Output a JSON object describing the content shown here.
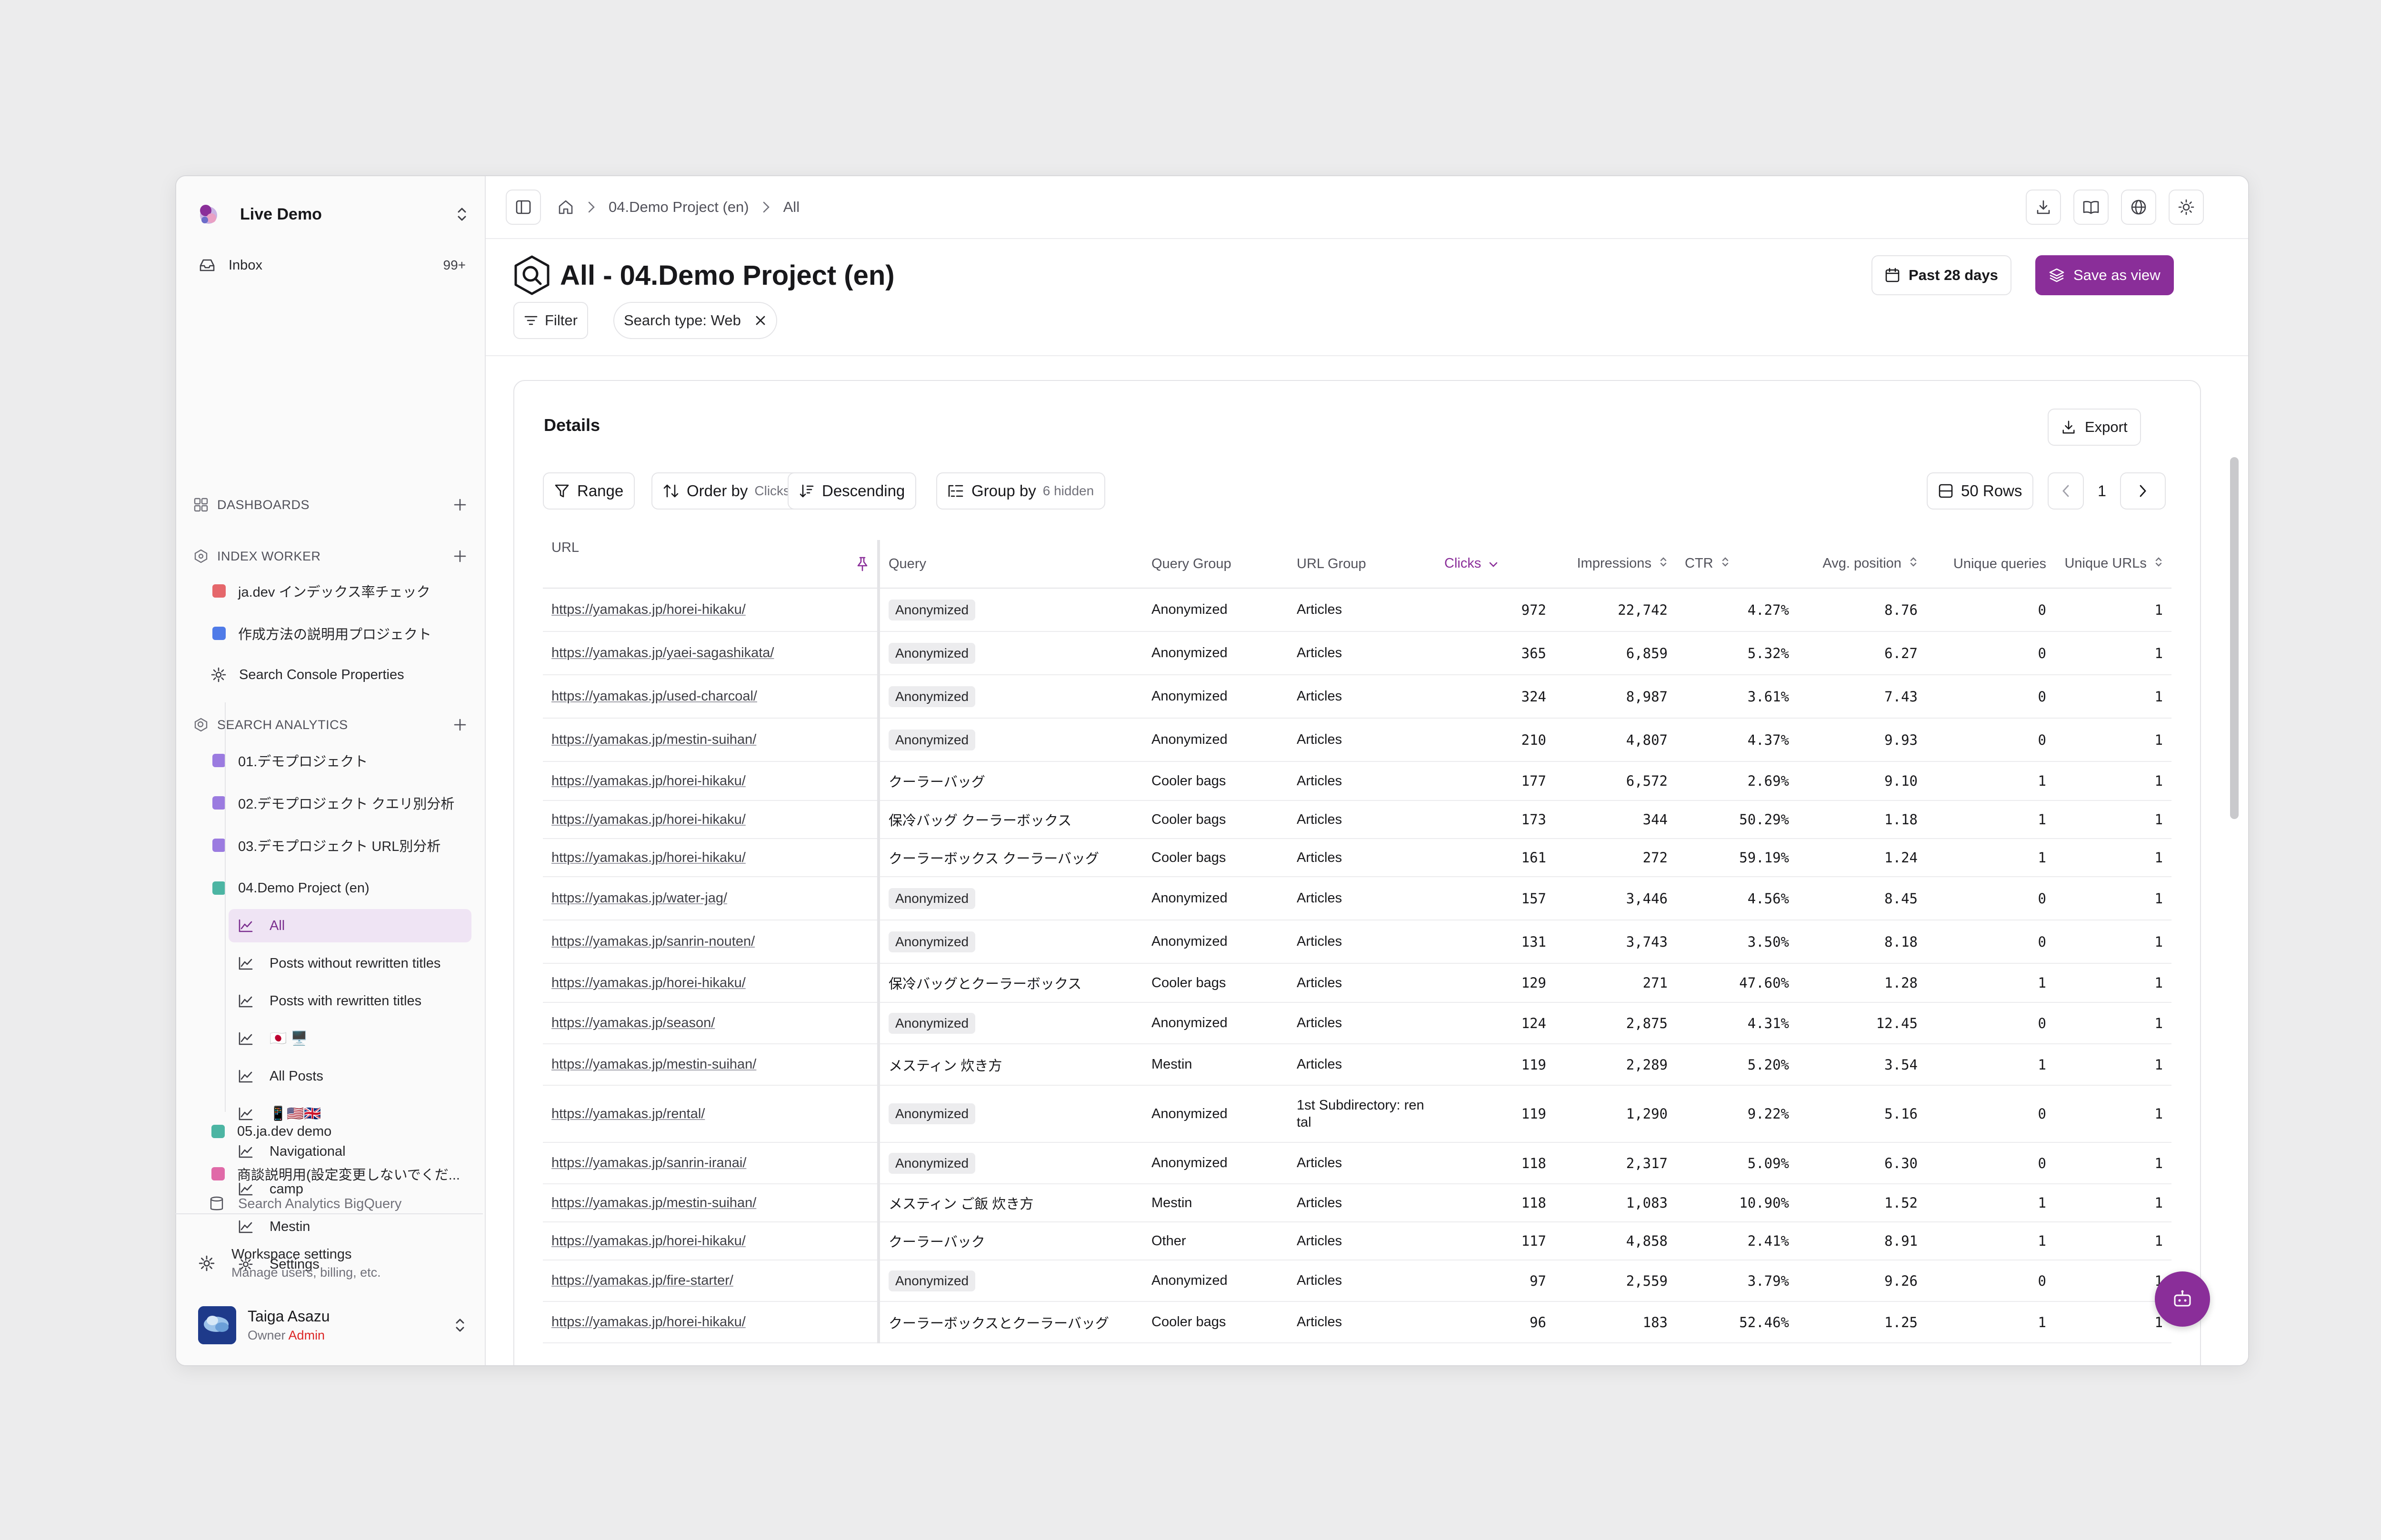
{
  "workspace": {
    "name": "Live Demo"
  },
  "inbox": {
    "label": "Inbox",
    "count": "99+"
  },
  "sections": {
    "dashboards": "DASHBOARDS",
    "index_worker": "INDEX WORKER",
    "search_analytics": "SEARCH ANALYTICS"
  },
  "index_worker_items": [
    {
      "label": "ja.dev インデックス率チェック",
      "color": "#e5676b"
    },
    {
      "label": "作成方法の説明用プロジェクト",
      "color": "#4f7be8"
    },
    {
      "label": "Search Console Properties",
      "icon": "gear-icon"
    }
  ],
  "analytics_items": [
    {
      "label": "01.デモプロジェクト",
      "color": "#9b7be0"
    },
    {
      "label": "02.デモプロジェクト クエリ別分析",
      "color": "#9b7be0"
    },
    {
      "label": "03.デモプロジェクト URL別分析",
      "color": "#9b7be0"
    },
    {
      "label": "04.Demo Project (en)",
      "color": "#4cb5a3"
    }
  ],
  "project_children": [
    {
      "label": "All",
      "active": true
    },
    {
      "label": "Posts without rewritten titles"
    },
    {
      "label": "Posts with rewritten titles"
    },
    {
      "label": "🇯🇵 🖥️"
    },
    {
      "label": "All Posts"
    },
    {
      "label": "📱🇺🇸🇬🇧"
    },
    {
      "label": "Navigational"
    },
    {
      "label": "camp"
    },
    {
      "label": "Mestin"
    },
    {
      "label": "Settings",
      "icon": "gear-icon"
    }
  ],
  "analytics_items_after": [
    {
      "label": "05.ja.dev demo",
      "color": "#4cb5a3"
    },
    {
      "label": "商談説明用(設定変更しないでくだ...",
      "color": "#e06aa8"
    },
    {
      "label": "Search Analytics BigQuery"
    }
  ],
  "workspace_settings": {
    "title": "Workspace settings",
    "subtitle": "Manage users, billing, etc."
  },
  "user": {
    "name": "Taiga Asazu",
    "role": "Owner",
    "badge": "Admin"
  },
  "breadcrumb": {
    "project": "04.Demo Project (en)",
    "current": "All"
  },
  "page": {
    "title": "All - 04.Demo Project (en)",
    "date_range": "Past 28 days",
    "save_view": "Save as view"
  },
  "filters": {
    "filter_label": "Filter",
    "search_type": "Search type: Web"
  },
  "details": {
    "title": "Details",
    "export": "Export",
    "range": "Range",
    "order_by": "Order by",
    "order_by_value": "Clicks",
    "direction": "Descending",
    "group_by": "Group by",
    "group_by_hidden": "6 hidden",
    "rows": "50 Rows",
    "page": "1"
  },
  "columns": {
    "url": "URL",
    "query": "Query",
    "query_group": "Query Group",
    "url_group": "URL Group",
    "clicks": "Clicks",
    "impressions": "Impressions",
    "ctr": "CTR",
    "avg_position": "Avg. position",
    "unique_queries": "Unique queries",
    "unique_urls": "Unique URLs"
  },
  "rows": [
    {
      "url": "https://yamakas.jp/horei-hikaku/",
      "query": "Anonymized",
      "anon": true,
      "qgroup": "Anonymized",
      "ugroup": "Articles",
      "clicks": "972",
      "impr": "22,742",
      "ctr": "4.27%",
      "pos": "8.76",
      "uq": "0",
      "uu": "1"
    },
    {
      "url": "https://yamakas.jp/yaei-sagashikata/",
      "query": "Anonymized",
      "anon": true,
      "qgroup": "Anonymized",
      "ugroup": "Articles",
      "clicks": "365",
      "impr": "6,859",
      "ctr": "5.32%",
      "pos": "6.27",
      "uq": "0",
      "uu": "1"
    },
    {
      "url": "https://yamakas.jp/used-charcoal/",
      "query": "Anonymized",
      "anon": true,
      "qgroup": "Anonymized",
      "ugroup": "Articles",
      "clicks": "324",
      "impr": "8,987",
      "ctr": "3.61%",
      "pos": "7.43",
      "uq": "0",
      "uu": "1"
    },
    {
      "url": "https://yamakas.jp/mestin-suihan/",
      "query": "Anonymized",
      "anon": true,
      "qgroup": "Anonymized",
      "ugroup": "Articles",
      "clicks": "210",
      "impr": "4,807",
      "ctr": "4.37%",
      "pos": "9.93",
      "uq": "0",
      "uu": "1"
    },
    {
      "url": "https://yamakas.jp/horei-hikaku/",
      "query": "クーラーバッグ",
      "anon": false,
      "qgroup": "Cooler bags",
      "ugroup": "Articles",
      "clicks": "177",
      "impr": "6,572",
      "ctr": "2.69%",
      "pos": "9.10",
      "uq": "1",
      "uu": "1"
    },
    {
      "url": "https://yamakas.jp/horei-hikaku/",
      "query": "保冷バッグ クーラーボックス",
      "anon": false,
      "qgroup": "Cooler bags",
      "ugroup": "Articles",
      "clicks": "173",
      "impr": "344",
      "ctr": "50.29%",
      "pos": "1.18",
      "uq": "1",
      "uu": "1"
    },
    {
      "url": "https://yamakas.jp/horei-hikaku/",
      "query": "クーラーボックス クーラーバッグ",
      "anon": false,
      "qgroup": "Cooler bags",
      "ugroup": "Articles",
      "clicks": "161",
      "impr": "272",
      "ctr": "59.19%",
      "pos": "1.24",
      "uq": "1",
      "uu": "1"
    },
    {
      "url": "https://yamakas.jp/water-jag/",
      "query": "Anonymized",
      "anon": true,
      "qgroup": "Anonymized",
      "ugroup": "Articles",
      "clicks": "157",
      "impr": "3,446",
      "ctr": "4.56%",
      "pos": "8.45",
      "uq": "0",
      "uu": "1"
    },
    {
      "url": "https://yamakas.jp/sanrin-nouten/",
      "query": "Anonymized",
      "anon": true,
      "qgroup": "Anonymized",
      "ugroup": "Articles",
      "clicks": "131",
      "impr": "3,743",
      "ctr": "3.50%",
      "pos": "8.18",
      "uq": "0",
      "uu": "1"
    },
    {
      "url": "https://yamakas.jp/horei-hikaku/",
      "query": "保冷バッグとクーラーボックス",
      "anon": false,
      "qgroup": "Cooler bags",
      "ugroup": "Articles",
      "clicks": "129",
      "impr": "271",
      "ctr": "47.60%",
      "pos": "1.28",
      "uq": "1",
      "uu": "1"
    },
    {
      "url": "https://yamakas.jp/season/",
      "query": "Anonymized",
      "anon": true,
      "qgroup": "Anonymized",
      "ugroup": "Articles",
      "clicks": "124",
      "impr": "2,875",
      "ctr": "4.31%",
      "pos": "12.45",
      "uq": "0",
      "uu": "1"
    },
    {
      "url": "https://yamakas.jp/mestin-suihan/",
      "query": "メスティン 炊き方",
      "anon": false,
      "qgroup": "Mestin",
      "ugroup": "Articles",
      "clicks": "119",
      "impr": "2,289",
      "ctr": "5.20%",
      "pos": "3.54",
      "uq": "1",
      "uu": "1"
    },
    {
      "url": "https://yamakas.jp/rental/",
      "query": "Anonymized",
      "anon": true,
      "qgroup": "Anonymized",
      "ugroup": "1st Subdirectory: rental",
      "clicks": "119",
      "impr": "1,290",
      "ctr": "9.22%",
      "pos": "5.16",
      "uq": "0",
      "uu": "1"
    },
    {
      "url": "https://yamakas.jp/sanrin-iranai/",
      "query": "Anonymized",
      "anon": true,
      "qgroup": "Anonymized",
      "ugroup": "Articles",
      "clicks": "118",
      "impr": "2,317",
      "ctr": "5.09%",
      "pos": "6.30",
      "uq": "0",
      "uu": "1"
    },
    {
      "url": "https://yamakas.jp/mestin-suihan/",
      "query": "メスティン ご飯 炊き方",
      "anon": false,
      "qgroup": "Mestin",
      "ugroup": "Articles",
      "clicks": "118",
      "impr": "1,083",
      "ctr": "10.90%",
      "pos": "1.52",
      "uq": "1",
      "uu": "1"
    },
    {
      "url": "https://yamakas.jp/horei-hikaku/",
      "query": "クーラーバック",
      "anon": false,
      "qgroup": "Other",
      "ugroup": "Articles",
      "clicks": "117",
      "impr": "4,858",
      "ctr": "2.41%",
      "pos": "8.91",
      "uq": "1",
      "uu": "1"
    },
    {
      "url": "https://yamakas.jp/fire-starter/",
      "query": "Anonymized",
      "anon": true,
      "qgroup": "Anonymized",
      "ugroup": "Articles",
      "clicks": "97",
      "impr": "2,559",
      "ctr": "3.79%",
      "pos": "9.26",
      "uq": "0",
      "uu": "1"
    },
    {
      "url": "https://yamakas.jp/horei-hikaku/",
      "query": "クーラーボックスとクーラーバッグ",
      "anon": false,
      "qgroup": "Cooler bags",
      "ugroup": "Articles",
      "clicks": "96",
      "impr": "183",
      "ctr": "52.46%",
      "pos": "1.25",
      "uq": "1",
      "uu": "1"
    }
  ]
}
